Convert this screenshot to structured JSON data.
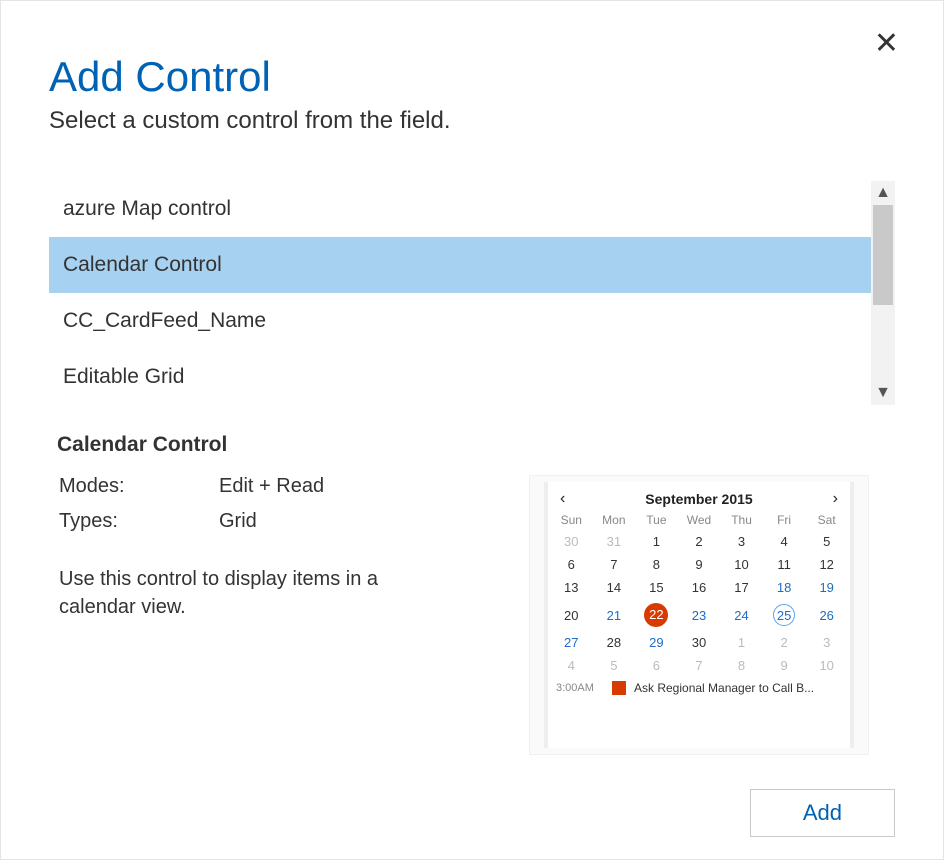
{
  "header": {
    "title": "Add Control",
    "subtitle": "Select a custom control from the field.",
    "close_glyph": "✕"
  },
  "list": {
    "items": [
      {
        "label": "azure Map control",
        "selected": false
      },
      {
        "label": "Calendar Control",
        "selected": true
      },
      {
        "label": "CC_CardFeed_Name",
        "selected": false
      },
      {
        "label": "Editable Grid",
        "selected": false
      }
    ],
    "scroll_up_glyph": "▲",
    "scroll_down_glyph": "▼"
  },
  "detail": {
    "name": "Calendar Control",
    "meta": {
      "modes_label": "Modes:",
      "modes_value": "Edit + Read",
      "types_label": "Types:",
      "types_value": "Grid"
    },
    "description": "Use this control to display items in a calendar view."
  },
  "calendar_preview": {
    "prev_glyph": "‹",
    "next_glyph": "›",
    "title": "September 2015",
    "weekdays": [
      "Sun",
      "Mon",
      "Tue",
      "Wed",
      "Thu",
      "Fri",
      "Sat"
    ],
    "weeks": [
      [
        {
          "d": "30",
          "dim": true
        },
        {
          "d": "31",
          "dim": true
        },
        {
          "d": "1"
        },
        {
          "d": "2"
        },
        {
          "d": "3"
        },
        {
          "d": "4"
        },
        {
          "d": "5"
        }
      ],
      [
        {
          "d": "6"
        },
        {
          "d": "7"
        },
        {
          "d": "8"
        },
        {
          "d": "9"
        },
        {
          "d": "10"
        },
        {
          "d": "11"
        },
        {
          "d": "12"
        }
      ],
      [
        {
          "d": "13"
        },
        {
          "d": "14"
        },
        {
          "d": "15"
        },
        {
          "d": "16"
        },
        {
          "d": "17"
        },
        {
          "d": "18",
          "link": true
        },
        {
          "d": "19",
          "link": true
        }
      ],
      [
        {
          "d": "20"
        },
        {
          "d": "21",
          "link": true
        },
        {
          "d": "22",
          "today": true
        },
        {
          "d": "23",
          "link": true
        },
        {
          "d": "24",
          "link": true
        },
        {
          "d": "25",
          "ring": true
        },
        {
          "d": "26",
          "link": true
        }
      ],
      [
        {
          "d": "27",
          "link": true
        },
        {
          "d": "28"
        },
        {
          "d": "29",
          "link": true
        },
        {
          "d": "30"
        },
        {
          "d": "1",
          "dim": true
        },
        {
          "d": "2",
          "dim": true
        },
        {
          "d": "3",
          "dim": true
        }
      ],
      [
        {
          "d": "4",
          "dim": true
        },
        {
          "d": "5",
          "dim": true
        },
        {
          "d": "6",
          "dim": true
        },
        {
          "d": "7",
          "dim": true
        },
        {
          "d": "8",
          "dim": true
        },
        {
          "d": "9",
          "dim": true
        },
        {
          "d": "10",
          "dim": true
        }
      ]
    ],
    "event": {
      "time": "3:00AM",
      "text": "Ask Regional Manager to Call B..."
    }
  },
  "footer": {
    "add_label": "Add"
  }
}
